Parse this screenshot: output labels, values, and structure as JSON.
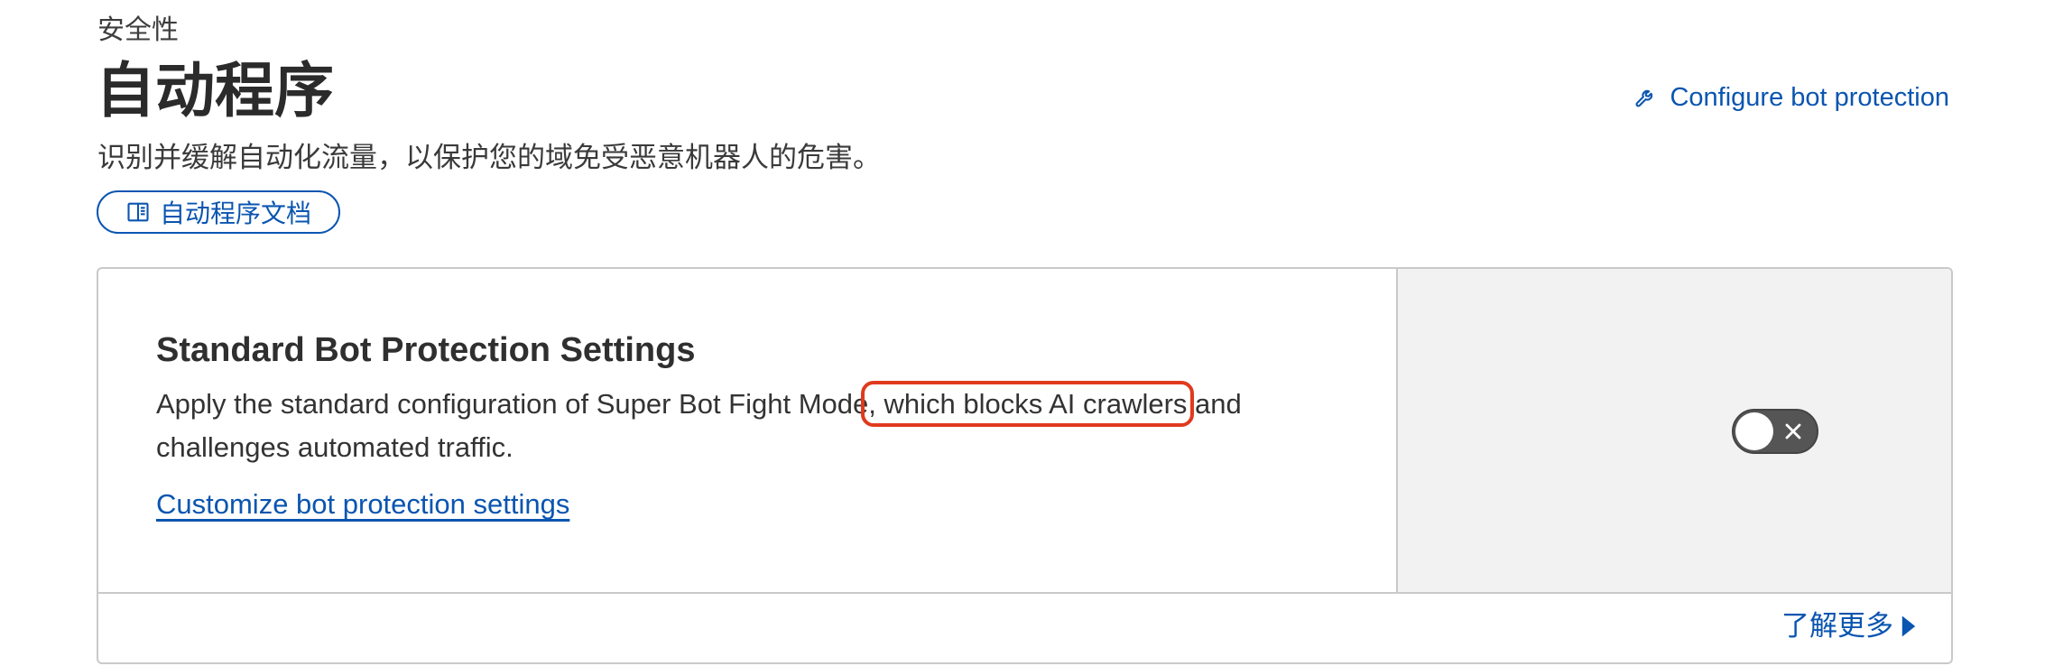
{
  "header": {
    "breadcrumb": "安全性",
    "title": "自动程序",
    "description": "识别并缓解自动化流量，以保护您的域免受恶意机器人的危害。",
    "docs_button_label": "自动程序文档",
    "configure_link_label": "Configure bot protection"
  },
  "card": {
    "title": "Standard Bot Protection Settings",
    "description_before": "Apply the standard configuration of Super Bot Fight Mode",
    "description_highlight": ", which blocks AI crawlers",
    "description_after": " and challenges automated traffic.",
    "customize_link_label": "Customize bot protection settings",
    "toggle_state": "off",
    "learn_more_label": "了解更多"
  },
  "colors": {
    "accent": "#0a55b0",
    "highlight_box": "#e03a1e",
    "toggle_off": "#555555",
    "panel_background": "#f2f2f2"
  }
}
